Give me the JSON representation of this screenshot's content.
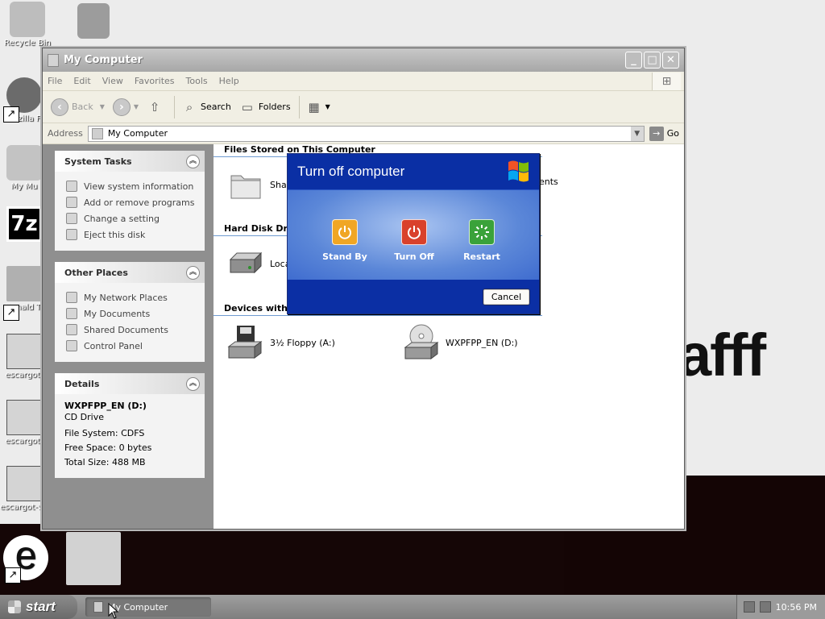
{
  "desktop": {
    "wallpaper_text": "afff",
    "icons": [
      {
        "label": "Recycle Bin"
      },
      {
        "label": "Mozilla Fi"
      },
      {
        "label": "My Mu"
      },
      {
        "label": "7z"
      },
      {
        "label": "Donald Tr"
      },
      {
        "label": "escargot-"
      },
      {
        "label": "escargot-"
      },
      {
        "label": "escargot-win"
      }
    ]
  },
  "window": {
    "title": "My Computer",
    "menu": [
      "File",
      "Edit",
      "View",
      "Favorites",
      "Tools",
      "Help"
    ],
    "toolbar": {
      "back": "Back",
      "search": "Search",
      "folders": "Folders"
    },
    "address": {
      "label": "Address",
      "value": "My Computer",
      "go": "Go"
    },
    "system_tasks": {
      "title": "System Tasks",
      "items": [
        "View system information",
        "Add or remove programs",
        "Change a setting",
        "Eject this disk"
      ]
    },
    "other_places": {
      "title": "Other Places",
      "items": [
        "My Network Places",
        "My Documents",
        "Shared Documents",
        "Control Panel"
      ]
    },
    "details": {
      "title": "Details",
      "name": "WXPFPP_EN (D:)",
      "type": "CD Drive",
      "fs": "File System: CDFS",
      "free": "Free Space: 0 bytes",
      "total": "Total Size: 488 MB"
    },
    "groups": {
      "files": "Files Stored on This Computer",
      "hdd": "Hard Disk Drives",
      "removable": "Devices with Removable Storage"
    },
    "items": {
      "shared": "Shared Documents",
      "shared_tail": "ents",
      "local": "Local Disk (C:)",
      "floppy": "3½ Floppy (A:)",
      "cd": "WXPFPP_EN (D:)"
    }
  },
  "dialog": {
    "title": "Turn off computer",
    "standby": "Stand By",
    "turnoff": "Turn Off",
    "restart": "Restart",
    "cancel": "Cancel",
    "colors": {
      "standby": "#f0a624",
      "turnoff": "#d9412b",
      "restart": "#3aa23a"
    }
  },
  "taskbar": {
    "start": "start",
    "task": "My Computer",
    "clock": "10:56 PM"
  }
}
